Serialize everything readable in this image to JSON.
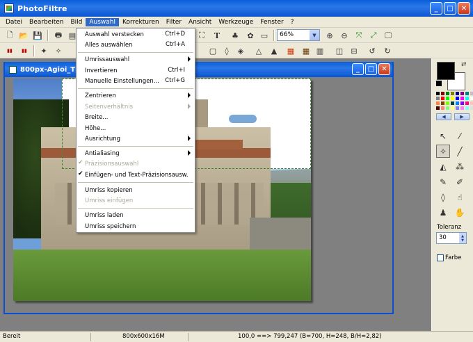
{
  "window": {
    "title": "PhotoFiltre"
  },
  "menubar": [
    "Datei",
    "Bearbeiten",
    "Bild",
    "Auswahl",
    "Korrekturen",
    "Filter",
    "Ansicht",
    "Werkzeuge",
    "Fenster",
    "?"
  ],
  "toolbar": {
    "zoom_value": "66%"
  },
  "child_window": {
    "title": "800px-Agioi_Th"
  },
  "auswahl_menu": {
    "items": [
      {
        "label": "Auswahl verstecken",
        "shortcut": "Ctrl+D"
      },
      {
        "label": "Alles auswählen",
        "shortcut": "Ctrl+A"
      },
      {
        "label": "Umrissauswahl"
      },
      {
        "label": "Invertieren",
        "shortcut": "Ctrl+I"
      },
      {
        "label": "Manuelle Einstellungen...",
        "shortcut": "Ctrl+G"
      },
      {
        "label": "Zentrieren"
      },
      {
        "label": "Seitenverhältnis"
      },
      {
        "label": "Breite..."
      },
      {
        "label": "Höhe..."
      },
      {
        "label": "Ausrichtung"
      },
      {
        "label": "Antialiasing"
      },
      {
        "label": "Präzisionsauswahl"
      },
      {
        "label": "Einfügen- und Text-Präzisionsausw."
      },
      {
        "label": "Umriss kopieren"
      },
      {
        "label": "Umriss einfügen"
      },
      {
        "label": "Umriss laden"
      },
      {
        "label": "Umriss speichern"
      }
    ]
  },
  "right_panel": {
    "tolerance_label": "Toleranz",
    "tolerance_value": "30",
    "color_checkbox_label": "Farbe",
    "foreground_color": "#000000",
    "background_color": "#ffffff"
  },
  "statusbar": {
    "status": "Bereit",
    "image_info": "800x600x16M",
    "coords": "100,0 ==> 799,247 (B=700, H=248, B/H=2,82)"
  },
  "colors": {
    "titlebar": "#0a5fd8",
    "menu_highlight": "#316ac5"
  }
}
